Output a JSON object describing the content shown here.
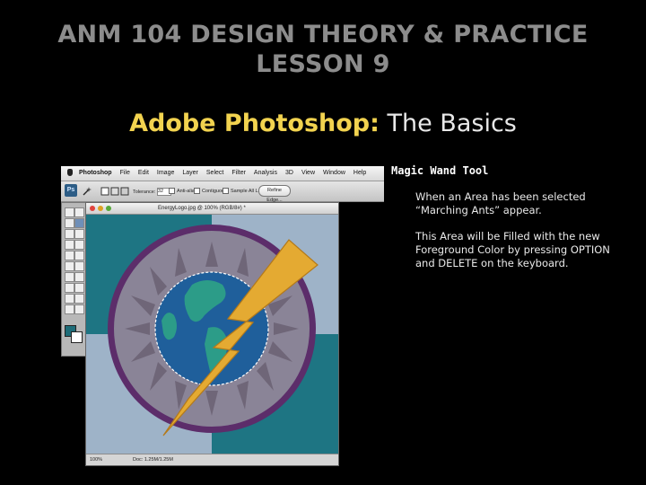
{
  "slide": {
    "course_line1": "ANM 104 DESIGN THEORY & PRACTICE",
    "course_line2": "LESSON 9",
    "heading_app": "Adobe Photoshop:",
    "heading_rest": " The Basics",
    "tool_title": "Magic Wand Tool",
    "paragraph1": "When an Area has been selected “Marching Ants” appear.",
    "paragraph2": "This Area will be Filled with the new Foreground Color by pressing OPTION and DELETE on the keyboard."
  },
  "screenshot": {
    "menu": [
      "Photoshop",
      "File",
      "Edit",
      "Image",
      "Layer",
      "Select",
      "Filter",
      "Analysis",
      "3D",
      "View",
      "Window",
      "Help"
    ],
    "options": {
      "tolerance_label": "Tolerance:",
      "tolerance_value": "32",
      "antialias_label": "Anti-alias",
      "contiguous_label": "Contiguous",
      "sample_label": "Sample All Layers",
      "refine_label": "Refine Edge..."
    },
    "doc_title": "EnergyLogo.jpg @ 100% (RGB/8#) *",
    "status_zoom": "100%",
    "status_doc": "Doc: 1.25M/1.25M",
    "colors": {
      "foreground": "#1e6c78",
      "background": "#ffffff",
      "canvas_light": "#9eb3c8",
      "canvas_teal": "#1e7583",
      "ring": "#5c2d6a",
      "disk": "#8a8497",
      "ocean": "#1f5f9b",
      "land": "#2c9c88",
      "bolt": "#e4aa32"
    }
  }
}
